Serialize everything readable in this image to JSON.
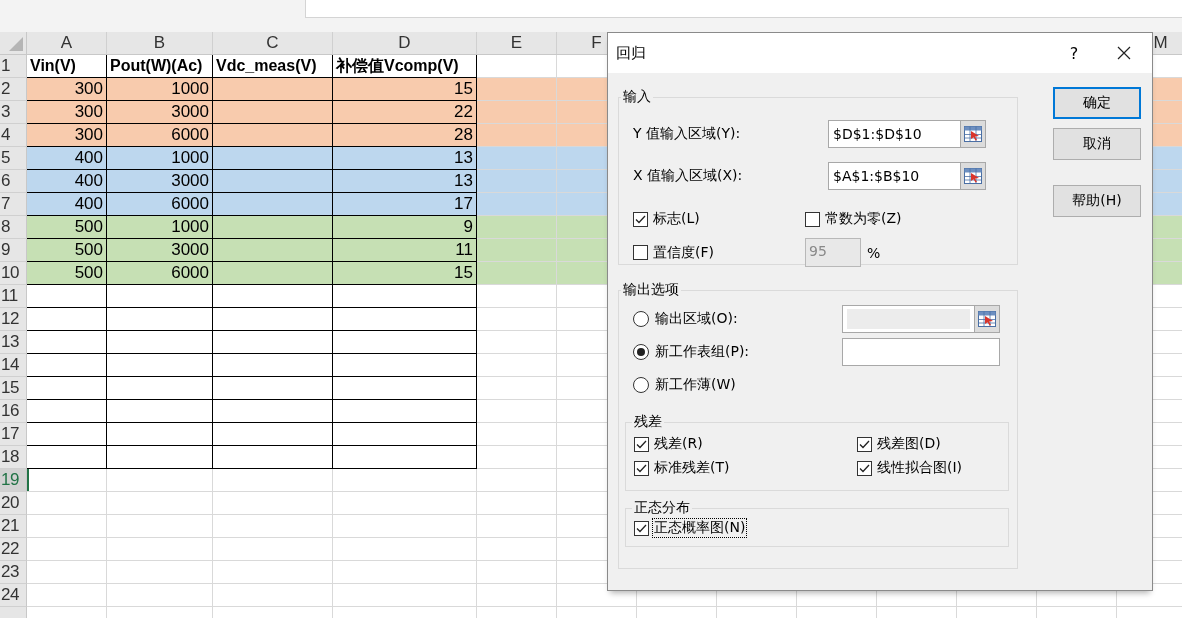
{
  "sheet": {
    "columns": [
      "A",
      "B",
      "C",
      "D",
      "E",
      "F",
      "M"
    ],
    "rows": [
      {
        "number": "1",
        "kind": "header",
        "selected": false,
        "A": "Vin(V)",
        "B": "Pout(W)(Ac)",
        "C": "Vdc_meas(V)",
        "D": "补偿值Vcomp(V)"
      },
      {
        "number": "2",
        "kind": "data",
        "selected": false,
        "color": "#f8cbad",
        "A": "300",
        "B": "1000",
        "D": "15"
      },
      {
        "number": "3",
        "kind": "data",
        "selected": false,
        "color": "#f8cbad",
        "A": "300",
        "B": "3000",
        "D": "22"
      },
      {
        "number": "4",
        "kind": "data",
        "selected": false,
        "color": "#f8cbad",
        "A": "300",
        "B": "6000",
        "D": "28"
      },
      {
        "number": "5",
        "kind": "data",
        "selected": false,
        "color": "#bdd7ee",
        "A": "400",
        "B": "1000",
        "D": "13"
      },
      {
        "number": "6",
        "kind": "data",
        "selected": false,
        "color": "#bdd7ee",
        "A": "400",
        "B": "3000",
        "D": "13"
      },
      {
        "number": "7",
        "kind": "data",
        "selected": false,
        "color": "#bdd7ee",
        "A": "400",
        "B": "6000",
        "D": "17"
      },
      {
        "number": "8",
        "kind": "data",
        "selected": false,
        "color": "#c6e0b4",
        "A": "500",
        "B": "1000",
        "D": "9"
      },
      {
        "number": "9",
        "kind": "data",
        "selected": false,
        "color": "#c6e0b4",
        "A": "500",
        "B": "3000",
        "D": "11"
      },
      {
        "number": "10",
        "kind": "data",
        "selected": false,
        "color": "#c6e0b4",
        "A": "500",
        "B": "6000",
        "D": "15"
      },
      {
        "number": "11",
        "kind": "bordered",
        "selected": false
      },
      {
        "number": "12",
        "kind": "bordered",
        "selected": false
      },
      {
        "number": "13",
        "kind": "bordered",
        "selected": false
      },
      {
        "number": "14",
        "kind": "bordered",
        "selected": false
      },
      {
        "number": "15",
        "kind": "bordered",
        "selected": false
      },
      {
        "number": "16",
        "kind": "bordered",
        "selected": false
      },
      {
        "number": "17",
        "kind": "bordered",
        "selected": false
      },
      {
        "number": "18",
        "kind": "bordered",
        "selected": false
      },
      {
        "number": "19",
        "kind": "blank",
        "selected": true
      },
      {
        "number": "20",
        "kind": "blank",
        "selected": false
      },
      {
        "number": "21",
        "kind": "blank",
        "selected": false
      },
      {
        "number": "22",
        "kind": "blank",
        "selected": false
      },
      {
        "number": "23",
        "kind": "blank",
        "selected": false
      },
      {
        "number": "24",
        "kind": "blank",
        "selected": false
      },
      {
        "kind": "blank",
        "selected": false
      }
    ]
  },
  "dialog": {
    "title": "回归",
    "help": "?",
    "input": {
      "legend": "输入",
      "ranges": [
        {
          "label": "Y 值输入区域(Y):",
          "value": "$D$1:$D$10"
        },
        {
          "label": "X 值输入区域(X):",
          "value": "$A$1:$B$10"
        }
      ],
      "options": [
        {
          "label": "标志(L)",
          "checked": true
        },
        {
          "label": "常数为零(Z)",
          "checked": false
        },
        {
          "label": "置信度(F)",
          "checked": false
        }
      ],
      "confidence": {
        "value": "95",
        "disabled": true,
        "unit": "%"
      }
    },
    "output": {
      "legend": "输出选项",
      "choices": [
        {
          "label": "输出区域(O):",
          "selected": false,
          "field": {
            "kind": "range",
            "disabled": true
          }
        },
        {
          "label": "新工作表组(P):",
          "selected": true,
          "field": {
            "kind": "text",
            "disabled": false
          }
        },
        {
          "label": "新工作薄(W)",
          "selected": false
        }
      ],
      "residuals": {
        "legend": "残差",
        "options": [
          {
            "label": "残差(R)",
            "checked": true
          },
          {
            "label": "残差图(D)",
            "checked": true
          },
          {
            "label": "标准残差(T)",
            "checked": true
          },
          {
            "label": "线性拟合图(I)",
            "checked": true
          }
        ]
      },
      "normal": {
        "legend": "正态分布",
        "options": [
          {
            "label": "正态概率图(N)",
            "checked": true,
            "focused": true
          }
        ]
      }
    },
    "buttons": [
      {
        "label": "确定",
        "default": true
      },
      {
        "label": "取消",
        "default": false
      },
      {
        "label": "帮助(H)",
        "default": false
      }
    ]
  }
}
